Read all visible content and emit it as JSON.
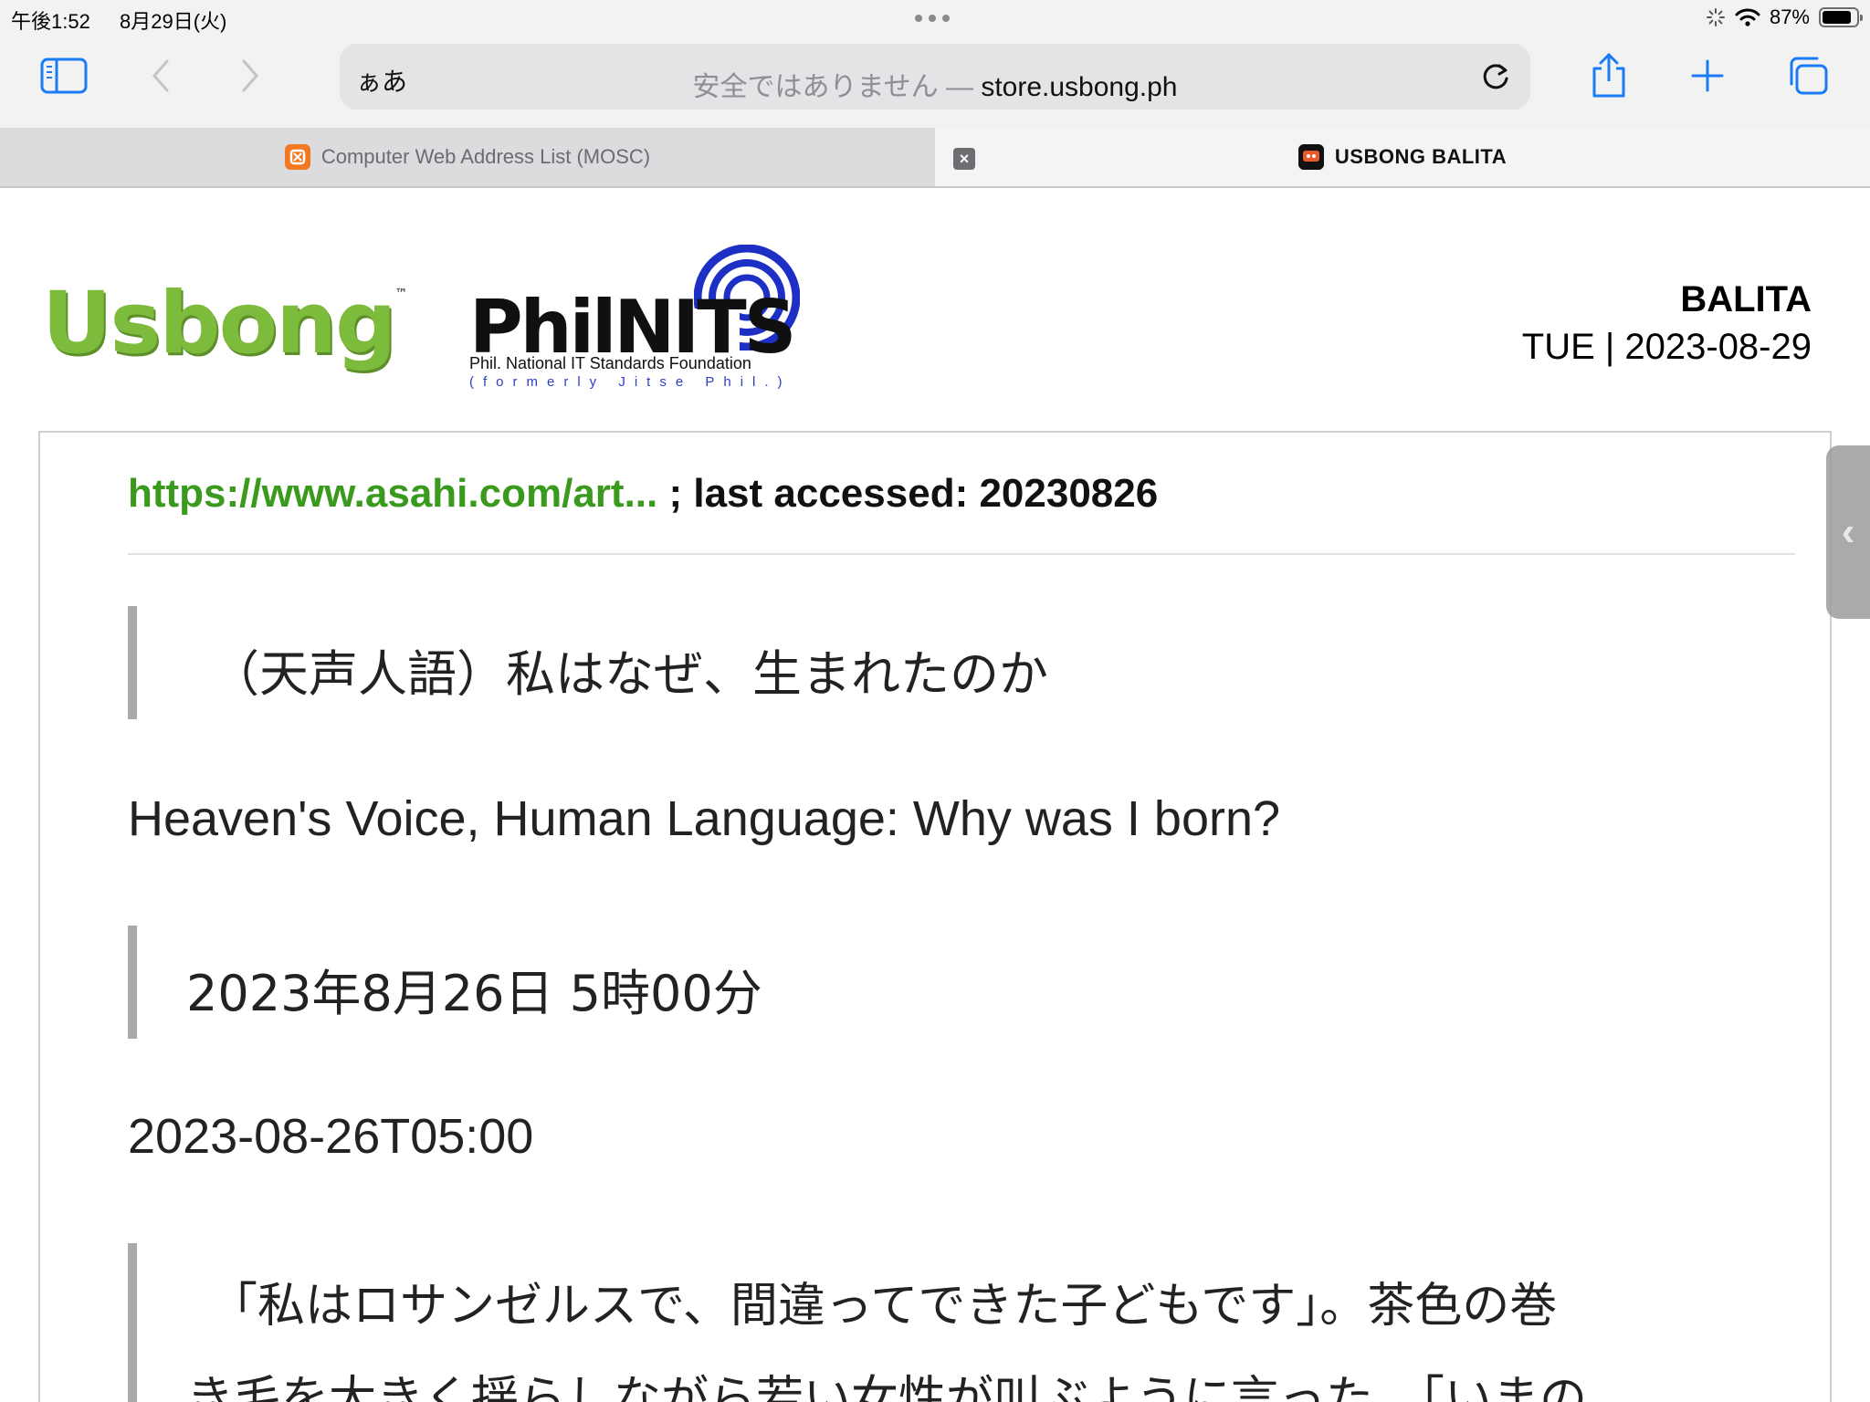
{
  "status": {
    "time": "午後1:52",
    "date": "8月29日(火)",
    "battery_text": "87%",
    "battery_level": 0.87
  },
  "toolbar": {
    "aa_label": "ぁあ",
    "insecure_label": "安全ではありません —",
    "host": "store.usbong.ph"
  },
  "tabs": [
    {
      "title": "Computer Web Address List (MOSC)",
      "active": false,
      "icon": "mosc-favicon-icon"
    },
    {
      "title": "USBONG BALITA",
      "active": true,
      "icon": "usbong-favicon-icon"
    }
  ],
  "header": {
    "logo_usbong": "Usbong",
    "logo_usbong_tm": "™",
    "logo_philnits": "PhilNITS",
    "philnits_line1": "Phil. National IT Standards Foundation",
    "philnits_line2": "(formerly Jitse Phil.)",
    "section": "BALITA",
    "day_date": "TUE | 2023-08-29"
  },
  "article": {
    "source_link": "https://www.asahi.com/art...",
    "source_suffix": " ; last accessed: 20230826",
    "title_ja": "（天声人語）私はなぜ、生まれたのか",
    "title_en": "Heaven's Voice, Human Language: Why was I born?",
    "date_ja": "2023年8月26日 5時00分",
    "date_iso": "2023-08-26T05:00",
    "body_line1": "「私はロサンゼルスで、間違ってできた子どもです」。茶色の巻",
    "body_line2": "き毛を大きく揺らしながら若い女性が叫ぶように言った。「いまの"
  },
  "colors": {
    "usbong_green": "#7dbb3c",
    "link_green": "#3a9a1e",
    "philnits_blue": "#2c3ec8",
    "safari_blue": "#1a7cf5"
  }
}
